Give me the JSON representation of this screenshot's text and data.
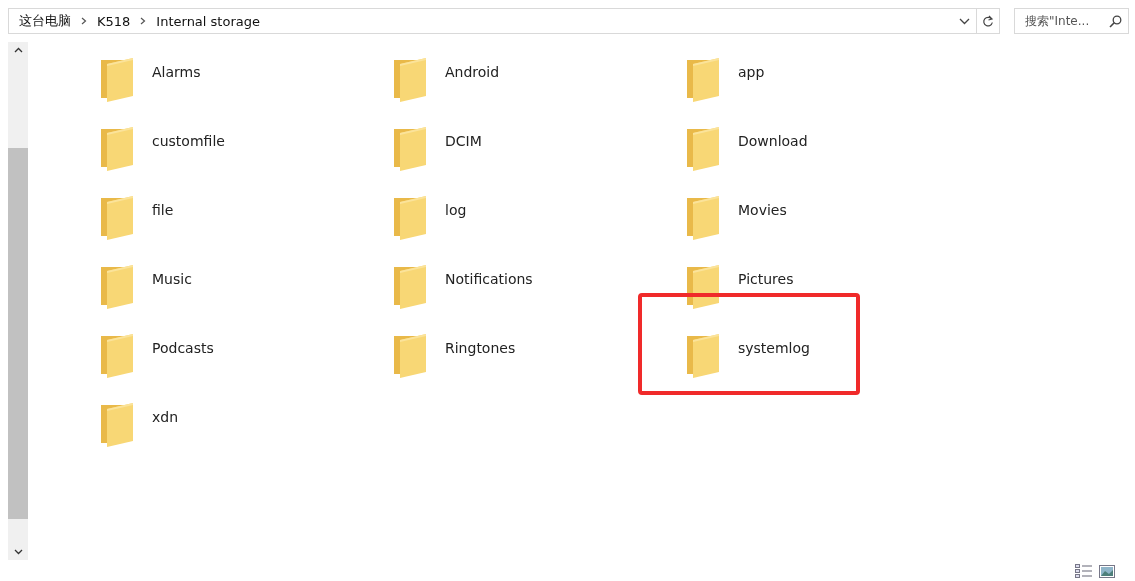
{
  "address_bar": {
    "breadcrumbs": [
      "这台电脑",
      "K518",
      "Internal storage"
    ]
  },
  "search": {
    "placeholder": "搜索\"Inte..."
  },
  "folders": [
    {
      "name": "Alarms",
      "highlighted": false
    },
    {
      "name": "Android",
      "highlighted": false
    },
    {
      "name": "app",
      "highlighted": false
    },
    {
      "name": "customfile",
      "highlighted": false
    },
    {
      "name": "DCIM",
      "highlighted": false
    },
    {
      "name": "Download",
      "highlighted": false
    },
    {
      "name": "file",
      "highlighted": false
    },
    {
      "name": "log",
      "highlighted": false
    },
    {
      "name": "Movies",
      "highlighted": false
    },
    {
      "name": "Music",
      "highlighted": false
    },
    {
      "name": "Notifications",
      "highlighted": false
    },
    {
      "name": "Pictures",
      "highlighted": false
    },
    {
      "name": "Podcasts",
      "highlighted": false
    },
    {
      "name": "Ringtones",
      "highlighted": false
    },
    {
      "name": "systemlog",
      "highlighted": true
    },
    {
      "name": "xdn",
      "highlighted": false
    }
  ]
}
